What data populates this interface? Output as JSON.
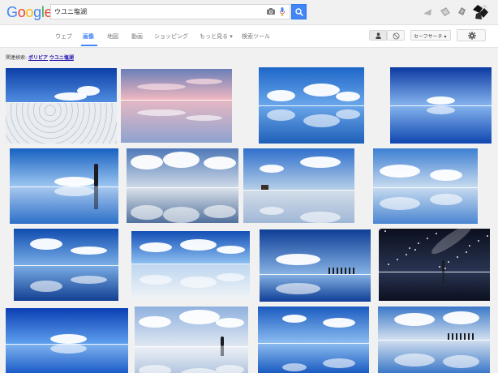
{
  "search": {
    "query": "ウユニ塩湖"
  },
  "logo": {
    "letters": [
      "G",
      "o",
      "o",
      "g",
      "l",
      "e"
    ],
    "colors": [
      "#4285f4",
      "#ea4335",
      "#fbbc05",
      "#4285f4",
      "#34a853",
      "#ea4335"
    ]
  },
  "nav": {
    "tabs": [
      {
        "label": "ウェブ",
        "active": false
      },
      {
        "label": "画像",
        "active": true
      },
      {
        "label": "地図",
        "active": false
      },
      {
        "label": "動画",
        "active": false
      },
      {
        "label": "ショッピング",
        "active": false
      },
      {
        "label": "もっと見る ▾",
        "active": false
      },
      {
        "label": "検索ツール",
        "active": false
      }
    ],
    "safe_search": "セーフサーチ ▾"
  },
  "related": {
    "label": "関連検索:",
    "links": [
      "ボリビア",
      "ウユニ塩湖"
    ]
  },
  "colors": {
    "accent": "#4285f4",
    "link": "#1a0dab"
  },
  "icons": [
    "camera-icon",
    "mic-icon",
    "search-icon",
    "person-icon",
    "safesearch-icon",
    "gear-icon"
  ]
}
